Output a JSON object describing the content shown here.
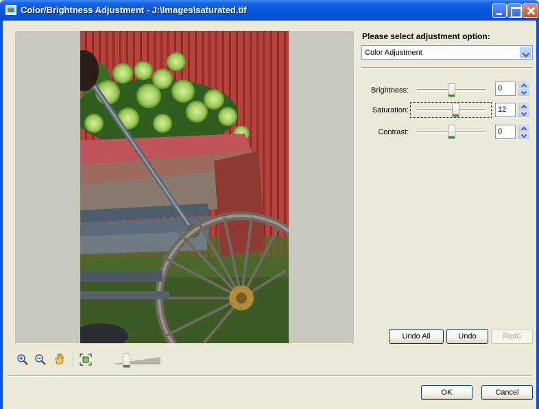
{
  "window": {
    "title": "Color/Brightness Adjustment - J:\\Images\\saturated.tif"
  },
  "panel": {
    "heading": "Please select adjustment option:",
    "option_selected": "Color Adjustment"
  },
  "adjustments": [
    {
      "label": "Brightness:",
      "value": "0",
      "level": 0.5
    },
    {
      "label": "Saturation:",
      "value": "12",
      "level": 0.56
    },
    {
      "label": "Contrast:",
      "value": "0",
      "level": 0.5
    }
  ],
  "history": {
    "undo_all": "Undo All",
    "undo": "Undo",
    "redo": "Redo"
  },
  "toolbar": {
    "icons": [
      "zoom-in-icon",
      "zoom-out-icon",
      "pan-hand-icon",
      "fit-to-window-icon"
    ],
    "zoom_level": 0.27
  },
  "dialog": {
    "ok": "OK",
    "cancel": "Cancel"
  },
  "colors": {
    "title_blue": "#0756e0",
    "slider_green": "#21a121",
    "preview_background": "#c9c8bf"
  }
}
